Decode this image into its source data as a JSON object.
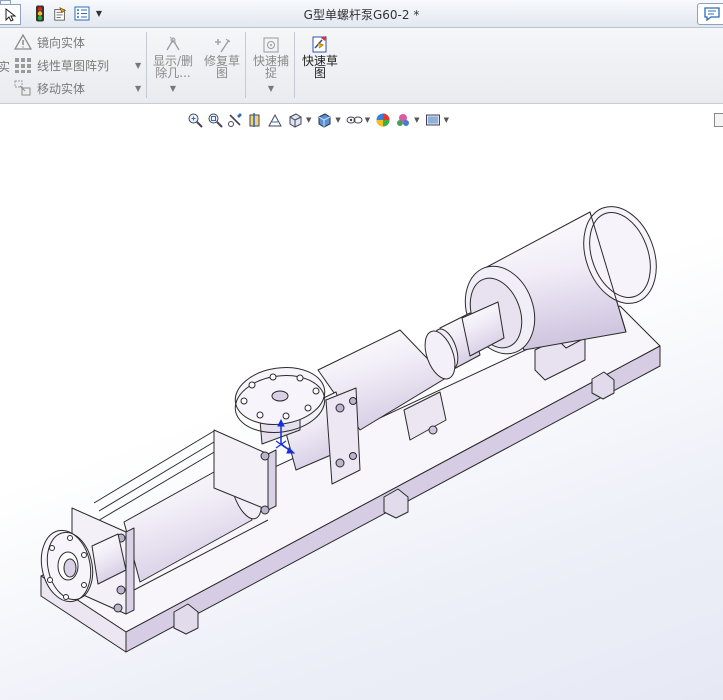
{
  "window": {
    "title": "G型单螺杆泵G60-2 *"
  },
  "quick_access": {
    "select_icon": "cursor-arrow-icon",
    "traffic_light_icon": "rebuild-icon",
    "properties_icon": "file-properties-icon",
    "options_icon": "options-list-icon"
  },
  "ribbon": {
    "mirror_label": "镜向实体",
    "linear_pattern_label": "线性草图阵列",
    "move_label": "移动实体",
    "cut_char": "实",
    "show_delete_label": "显示/删\n除几...",
    "repair_label": "修复草\n图",
    "quick_snap_label": "快速捕\n捉",
    "rapid_sketch_label": "快速草\n图"
  },
  "heads_up_toolbar": {
    "icons": [
      "zoom-to-fit-icon",
      "zoom-area-icon",
      "previous-view-icon",
      "section-view-icon",
      "dynamic-annotation-icon",
      "view-orientation-icon",
      "display-style-icon",
      "hide-show-icon",
      "edit-appearance-icon",
      "apply-scene-icon",
      "view-settings-icon"
    ]
  },
  "colors": {
    "model_fill": "#f7f4fb",
    "model_shade": "#d9d2e6",
    "model_edge": "#2b2b2b",
    "axis_blue": "#1530d8"
  }
}
